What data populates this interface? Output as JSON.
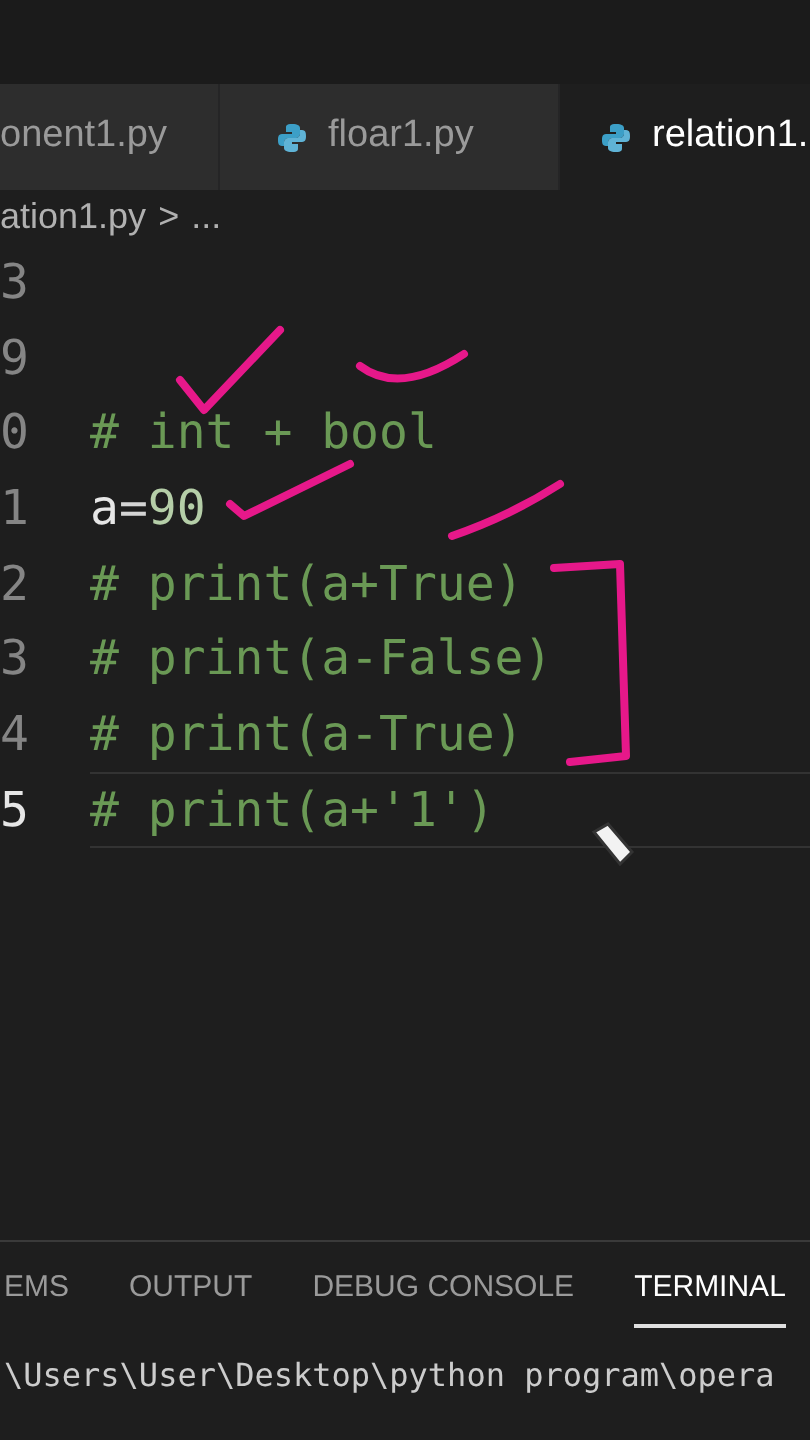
{
  "tabs": [
    {
      "label": "onent1.py",
      "icon": false,
      "selected": false
    },
    {
      "label": "floar1.py",
      "icon": true,
      "selected": false
    },
    {
      "label": "relation1.",
      "icon": true,
      "selected": true
    }
  ],
  "breadcrumb": {
    "file": "ation1.py",
    "separator": ">",
    "more": "..."
  },
  "editor": {
    "lines": [
      {
        "number": "3",
        "active": false
      },
      {
        "number": "9",
        "active": false
      },
      {
        "number": "0",
        "active": false,
        "tokens": [
          {
            "text": "# int + bool",
            "kind": "comment"
          }
        ]
      },
      {
        "number": "1",
        "active": false,
        "tokens": [
          {
            "text": "a",
            "kind": "variable"
          },
          {
            "text": "=",
            "kind": "operator"
          },
          {
            "text": "90",
            "kind": "number"
          }
        ]
      },
      {
        "number": "2",
        "active": false,
        "tokens": [
          {
            "text": "# print(a+True)",
            "kind": "comment"
          }
        ]
      },
      {
        "number": "3",
        "active": false,
        "tokens": [
          {
            "text": "# print(a-False)",
            "kind": "comment"
          }
        ]
      },
      {
        "number": "4",
        "active": false,
        "tokens": [
          {
            "text": "# print(a-True)",
            "kind": "comment"
          }
        ]
      },
      {
        "number": "5",
        "active": true,
        "tokens": [
          {
            "text": "# print(a+'1')",
            "kind": "comment"
          }
        ]
      }
    ]
  },
  "panel": {
    "tabs": [
      {
        "label": "EMS",
        "selected": false
      },
      {
        "label": "OUTPUT",
        "selected": false
      },
      {
        "label": "DEBUG CONSOLE",
        "selected": false
      },
      {
        "label": "TERMINAL",
        "selected": true
      }
    ],
    "terminal_line": "\\Users\\User\\Desktop\\python program\\opera"
  }
}
